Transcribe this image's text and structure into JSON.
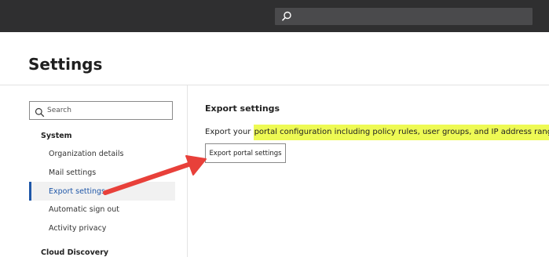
{
  "header": {
    "search_icon": "search-icon"
  },
  "page": {
    "title": "Settings"
  },
  "sidebar": {
    "search_placeholder": "Search",
    "groups": [
      {
        "title": "System",
        "items": [
          {
            "label": "Organization details"
          },
          {
            "label": "Mail settings"
          },
          {
            "label": "Export settings",
            "active": true
          },
          {
            "label": "Automatic sign out"
          },
          {
            "label": "Activity privacy"
          }
        ]
      },
      {
        "title": "Cloud Discovery",
        "items": []
      }
    ]
  },
  "main": {
    "section_title": "Export settings",
    "description_prefix": "Export your ",
    "description_highlight": "portal configuration including policy rules, user groups, and IP address ranges.",
    "button_label": "Export portal settings"
  },
  "colors": {
    "topbar": "#2f2f30",
    "accent": "#1f57a8",
    "highlight": "#eefa54",
    "annotation_arrow": "#e8403a"
  }
}
